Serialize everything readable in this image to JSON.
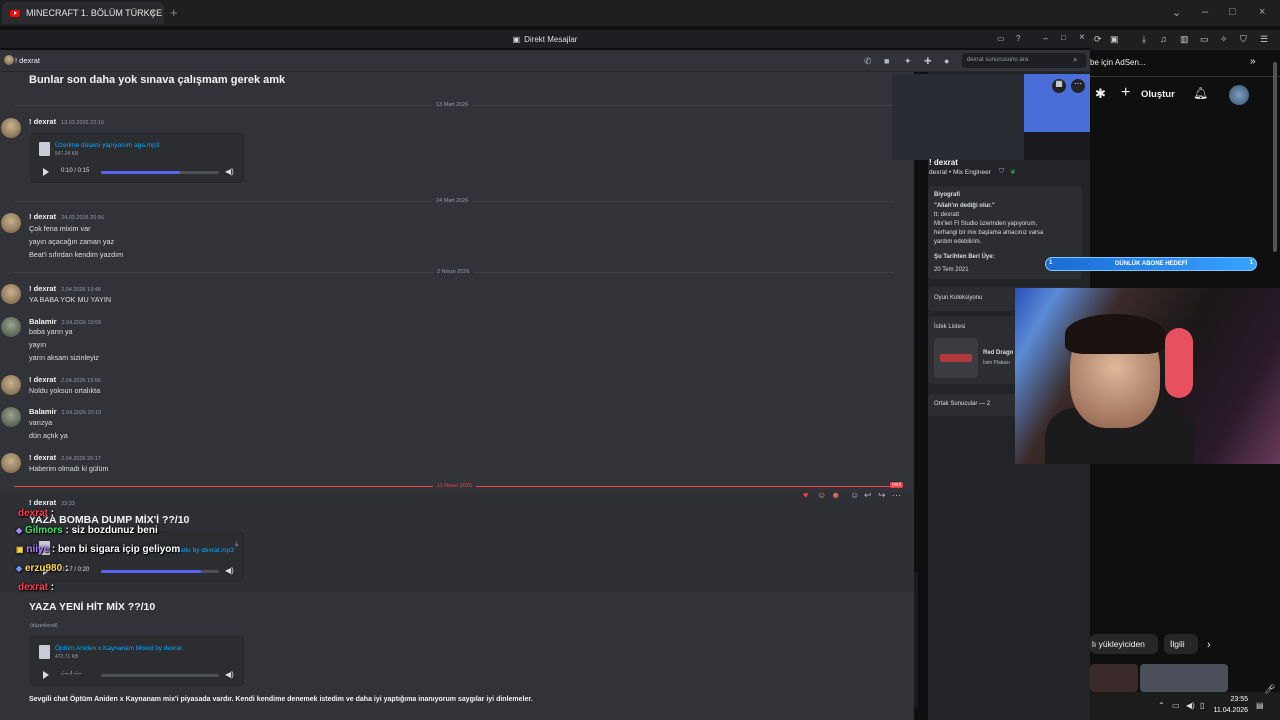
{
  "browser": {
    "tab_title": "MINECRAFT 1. BÖLÜM TÜRKÇE",
    "new_tab": "+",
    "yt_ad_text": "be için AdSen...",
    "create_label": "Oluştur",
    "yt_chip_1": "lı yükleyiciden",
    "yt_chip_2": "İlgili"
  },
  "discord": {
    "window_title": "Direkt Mesajlar",
    "dm_name": "! dexrat",
    "search_placeholder": "dexrat sunucusunu ara",
    "top_message": "Bunlar son daha yok sınava çalışmam gerek amk",
    "dividers": [
      "13 Mart 2026",
      "24 Mart 2026",
      "2 Nisan 2026",
      "11 Nisan 2026"
    ],
    "m1": {
      "user": "! dexrat",
      "time": "13.03.2026 22:16",
      "file": "Üzerime düşeni yapıyorum aga.mp3",
      "size": "547.04 KB",
      "playtime": "0:10 / 0:15"
    },
    "m2": {
      "user": "! dexrat",
      "time": "24.03.2026 20:56",
      "l1": "Çok fena mixim var",
      "l2": "yayın açacağın zaman yaz",
      "l3": "Beat'i sıfırdan kendim yazdım"
    },
    "m3": {
      "user": "! dexrat",
      "time": "2.04.2026 19:48",
      "l1": "YA BABA YOK MU YAYIN"
    },
    "m4": {
      "user": "Balamir",
      "time": "2.04.2026 19:55",
      "l1": "baba yarın ya",
      "l2": "yayın",
      "l3": "yarın aksam sizinleyiz"
    },
    "m5": {
      "user": "! dexrat",
      "time": "2.04.2026 19:56",
      "l1": "Noldu yoksun ortalıkta"
    },
    "m6": {
      "user": "Balamir",
      "time": "2.04.2026 20:10",
      "l1": "varızya",
      "l2": "dün açtık ya"
    },
    "m7": {
      "user": "! dexrat",
      "time": "2.04.2026 20:17",
      "l1": "Haberim olmadı ki gülüm"
    },
    "m8": {
      "user": "! dexrat",
      "time": "23:33",
      "title": "YAZA BOMBA DUMP MİX'İ ??/10",
      "file": "Bu şarkı by dexrat.mp3",
      "playtime": "0:17 / 0:20"
    },
    "m9": {
      "title": "YAZA YENİ HİT MİX ??/10",
      "edited": "(düzenlendi)",
      "file": "Öptüm Aniden x Kaynanam Mixed by dexrat",
      "size": "472.71 KB",
      "playtime": "-:-- / -:--",
      "caption": "Sevgili chat Öptüm Aniden x Kaynanam mix'i piyasada vardır. Kendi kendime denemek istedim ve daha iyi yaptığıma inanıyorum saygılar iyi dinlemeler."
    },
    "new_badge": "yeni"
  },
  "profile": {
    "name": "! dexrat",
    "tagline": "dexrat • Mix Engineer",
    "bio_title": "Biyografi",
    "bio_lines": [
      "\"Allah'ın dediği olur.\"",
      "tt: dexratt",
      "Mix'leri Fl Studio üzerinden yapıyorum,",
      "herhangi bir mix başlama amacınız varsa",
      "yardım edebilirim."
    ],
    "member_since_title": "Şu Tarihten Beri Üye:",
    "member_since": "20 Tem 2021",
    "game_collection": "Oyun Koleksiyonu",
    "wishlist": "İstek Listesi",
    "wish_item": "Red Drago",
    "wish_item_sub": "İsim Plakası",
    "common_servers": "Ortak Sunucular — 2"
  },
  "stream_overlay": {
    "sub_goal": "GÜNLÜK ABONE HEDEFİ",
    "sub_left": "1",
    "sub_right": "1",
    "chat": [
      {
        "user": "dexrat",
        "text": ":",
        "color": "#ff3b4e"
      },
      {
        "user": "Gilmors",
        "text": ": siz bozdunuz beni",
        "color": "#38e06a"
      },
      {
        "user": "niiye",
        "text": ": ben bi sigara içip geliyom",
        "color": "#b07cff"
      },
      {
        "user": "erzu980",
        "text": ":",
        "color": "#ffd84a"
      },
      {
        "user": "dexrat",
        "text": ":",
        "color": "#ff3b4e"
      }
    ]
  },
  "taskbar": {
    "time": "23:55",
    "date": "11.04.2026"
  }
}
